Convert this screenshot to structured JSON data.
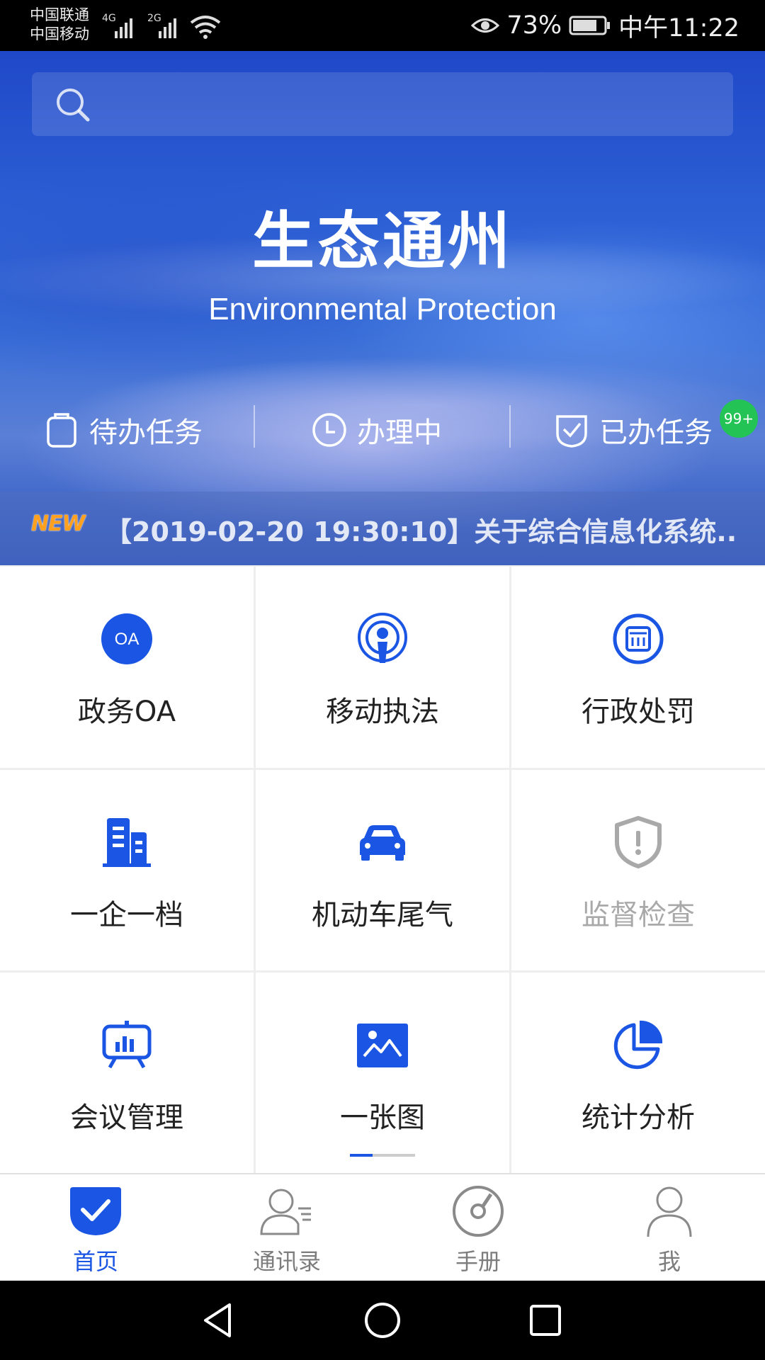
{
  "status_bar": {
    "carrier_1": "中国联通",
    "carrier_2": "中国移动",
    "network_1": "4G",
    "network_2": "2G",
    "battery": "73%",
    "time": "中午11:22"
  },
  "search": {
    "placeholder": ""
  },
  "hero": {
    "title": "生态通州",
    "subtitle": "Environmental Protection"
  },
  "tasks": [
    {
      "label": "待办任务",
      "icon": "clipboard-icon"
    },
    {
      "label": "办理中",
      "icon": "clock-icon"
    },
    {
      "label": "已办任务",
      "icon": "check-shield-icon",
      "badge": "99+"
    }
  ],
  "news": {
    "tag": "NEW",
    "text": "【2019-02-20 19:30:10】关于综合信息化系统.."
  },
  "modules": [
    {
      "label": "政务OA",
      "icon": "oa-icon",
      "enabled": true
    },
    {
      "label": "移动执法",
      "icon": "podcast-icon",
      "enabled": true
    },
    {
      "label": "行政处罚",
      "icon": "penalty-icon",
      "enabled": true
    },
    {
      "label": "一企一档",
      "icon": "building-icon",
      "enabled": true
    },
    {
      "label": "机动车尾气",
      "icon": "car-icon",
      "enabled": true
    },
    {
      "label": "监督检查",
      "icon": "shield-alert-icon",
      "enabled": false
    },
    {
      "label": "会议管理",
      "icon": "presentation-icon",
      "enabled": true
    },
    {
      "label": "一张图",
      "icon": "image-icon",
      "enabled": true
    },
    {
      "label": "统计分析",
      "icon": "pie-chart-icon",
      "enabled": true
    }
  ],
  "bottom_nav": [
    {
      "label": "首页",
      "icon": "home-check-icon",
      "active": true
    },
    {
      "label": "通讯录",
      "icon": "contacts-icon",
      "active": false
    },
    {
      "label": "手册",
      "icon": "compass-icon",
      "active": false
    },
    {
      "label": "我",
      "icon": "person-icon",
      "active": false
    }
  ],
  "colors": {
    "accent": "#1a55e3",
    "badge": "#23c355",
    "new_tag": "#ffa01e",
    "disabled": "#a9a9a9"
  }
}
